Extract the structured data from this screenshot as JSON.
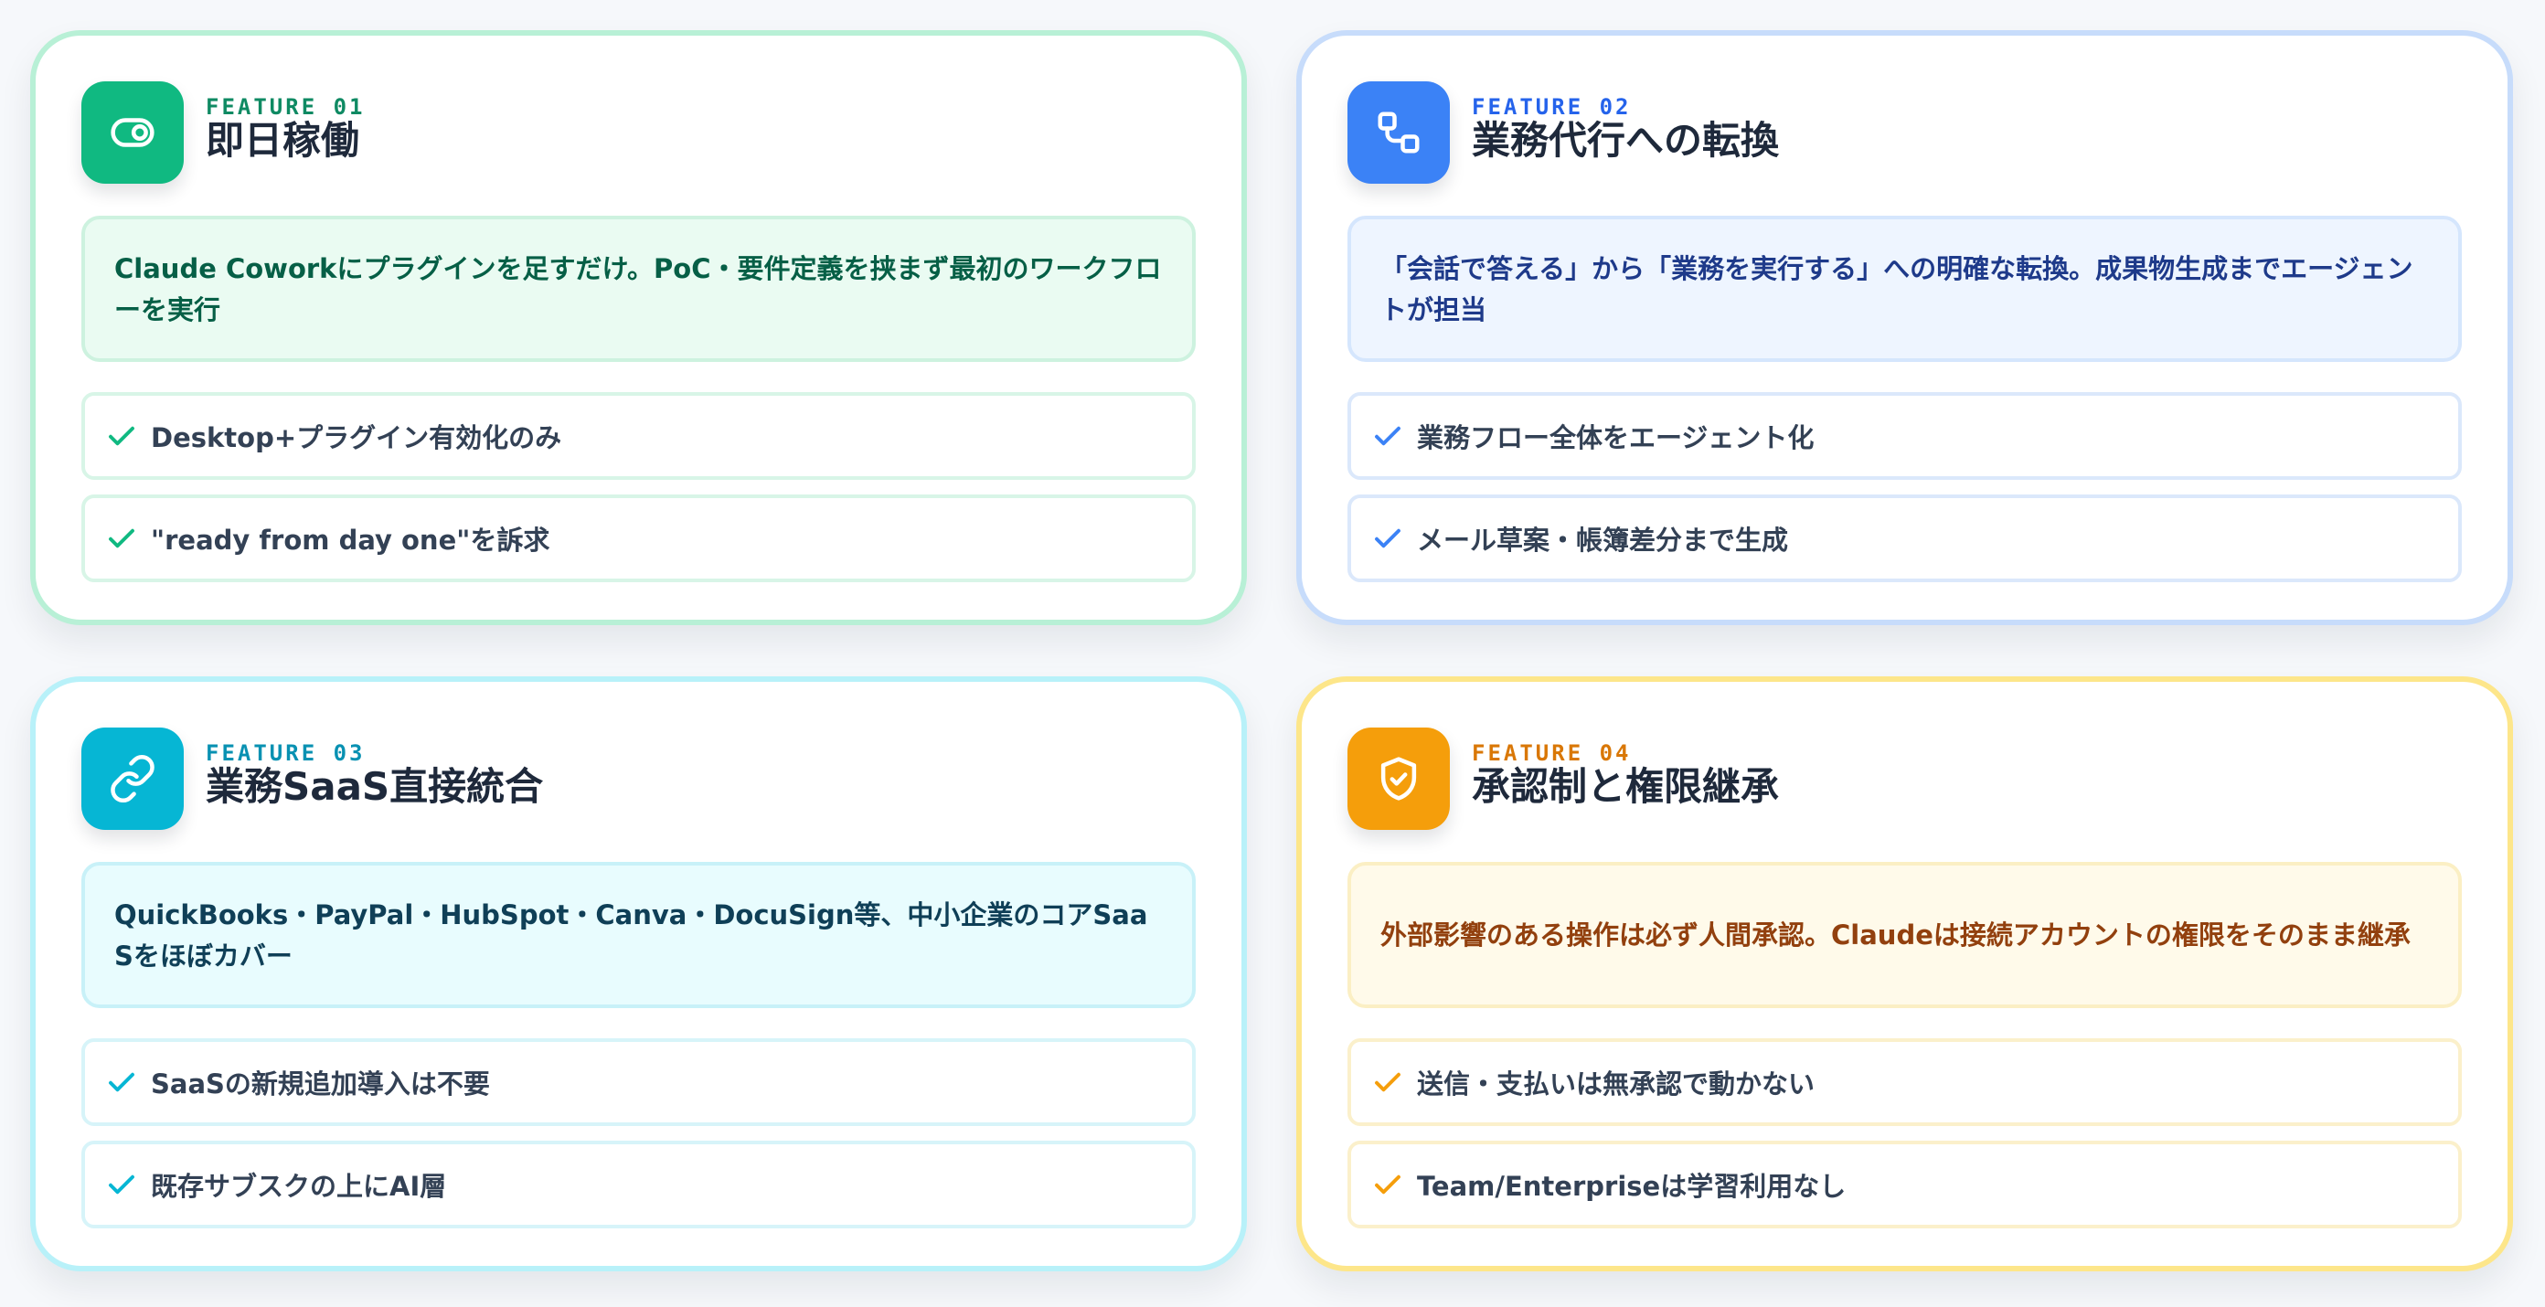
{
  "features": [
    {
      "tag": "FEATURE 01",
      "title": "即日稼働",
      "icon": "toggle-icon",
      "description": "Claude Coworkにプラグインを足すだけ。PoC・要件定義を挟まず最初のワークフローを実行",
      "items": [
        {
          "text": "Desktop+プラグイン有効化のみ"
        },
        {
          "text": "\"ready from day one\"を訴求"
        }
      ],
      "colors": {
        "accent": "#10b981",
        "tag": "#0f8a63",
        "border": "#b8f0d6",
        "description_bg": "#eafbf2",
        "description_text": "#065f46"
      }
    },
    {
      "tag": "FEATURE 02",
      "title": "業務代行への転換",
      "icon": "workflow-icon",
      "description": "「会話で答える」から「業務を実行する」への明確な転換。成果物生成までエージェントが担当",
      "items": [
        {
          "text": "業務フロー全体をエージェント化"
        },
        {
          "text": "メール草案・帳簿差分まで生成"
        }
      ],
      "colors": {
        "accent": "#3b82f6",
        "tag": "#2563eb",
        "border": "#c7dcfb",
        "description_bg": "#eef5ff",
        "description_text": "#1e3a8a"
      }
    },
    {
      "tag": "FEATURE 03",
      "title": "業務SaaS直接統合",
      "icon": "link-icon",
      "description": "QuickBooks・PayPal・HubSpot・Canva・DocuSign等、中小企業のコアSaaSをほぼカバー",
      "items": [
        {
          "text": "SaaSの新規追加導入は不要"
        },
        {
          "text": "既存サブスクの上にAI層"
        }
      ],
      "colors": {
        "accent": "#06b6d4",
        "tag": "#0891b2",
        "border": "#b8f1f9",
        "description_bg": "#e8fcfe",
        "description_text": "#0f3f57"
      }
    },
    {
      "tag": "FEATURE 04",
      "title": "承認制と権限継承",
      "icon": "shield-check-icon",
      "description": "外部影響のある操作は必ず人間承認。Claudeは接続アカウントの権限をそのまま継承",
      "items": [
        {
          "text": "送信・支払いは無承認で動かない"
        },
        {
          "text": "Team/Enterpriseは学習利用なし"
        }
      ],
      "colors": {
        "accent": "#f59e0b",
        "tag": "#d97706",
        "border": "#fde68a",
        "description_bg": "#fffaea",
        "description_text": "#92400e"
      }
    }
  ]
}
